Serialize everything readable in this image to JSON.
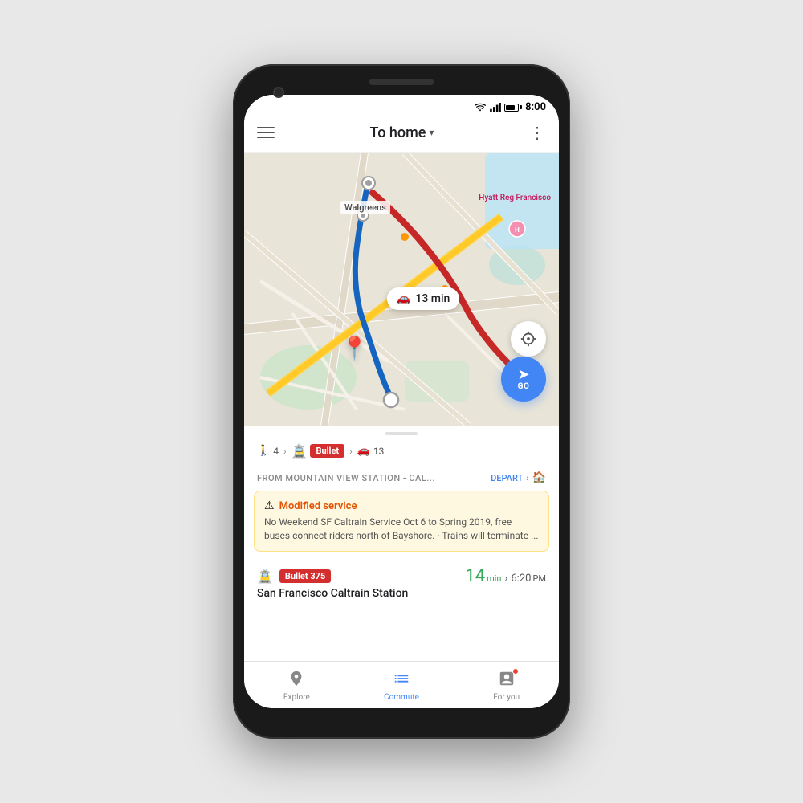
{
  "status_bar": {
    "time": "8:00"
  },
  "header": {
    "title": "To home",
    "title_arrow": "▾",
    "menu_label": "Menu",
    "more_label": "More options"
  },
  "map": {
    "drive_time": "13 min",
    "go_button_label": "GO",
    "walgreens_label": "Walgreens",
    "hyatt_label": "Hyatt Reg\nFrancisco"
  },
  "route_summary": {
    "walk_mins": "4",
    "bullet_label": "Bullet",
    "drive_mins": "13"
  },
  "station": {
    "name": "FROM MOUNTAIN VIEW STATION - CAL...",
    "depart_label": "DEPART"
  },
  "alert": {
    "icon": "⚠",
    "title": "Modified service",
    "body": "No Weekend SF Caltrain Service Oct 6 to Spring 2019, free buses connect riders north of Bayshore. · Trains will terminate ..."
  },
  "train_option": {
    "bullet_label": "Bullet 375",
    "station_name": "San Francisco Caltrain Station",
    "minutes": "14",
    "minutes_label": "min",
    "depart_arrow": "›",
    "depart_time": "6:20",
    "depart_period": "PM"
  },
  "bottom_nav": {
    "explore_label": "Explore",
    "commute_label": "Commute",
    "for_you_label": "For you"
  }
}
